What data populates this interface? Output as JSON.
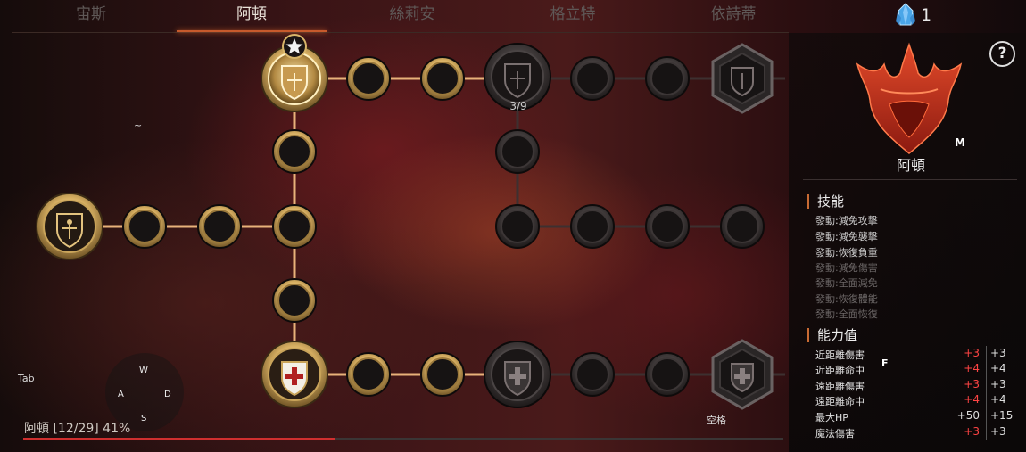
{
  "tabs": [
    {
      "label": "宙斯"
    },
    {
      "label": "阿頓"
    },
    {
      "label": "絲莉安"
    },
    {
      "label": "格立特"
    },
    {
      "label": "依詩蒂"
    }
  ],
  "active_tab": 1,
  "currency": {
    "icon": "crystal-icon",
    "count": "1",
    "color": "#4aa6e8"
  },
  "help": {
    "label": "?"
  },
  "character": {
    "name": "阿頓",
    "emblem_icon": "winged-crest-icon",
    "emblem_color": "#c2331f",
    "hotkey": "M"
  },
  "skills": {
    "title": "技能",
    "items": [
      {
        "label": "發動:減免攻擊",
        "active": true
      },
      {
        "label": "發動:減免襲擊",
        "active": true
      },
      {
        "label": "發動:恢復負重",
        "active": true
      },
      {
        "label": "發動:減免傷害",
        "active": false
      },
      {
        "label": "發動:全面減免",
        "active": false
      },
      {
        "label": "發動:恢復體能",
        "active": false
      },
      {
        "label": "發動:全面恢復",
        "active": false
      }
    ]
  },
  "stats": {
    "title": "能力值",
    "hotkey": "F",
    "rows": [
      {
        "label": "近距離傷害",
        "bonus": "+3",
        "total": "+3"
      },
      {
        "label": "近距離命中",
        "bonus": "+4",
        "total": "+4"
      },
      {
        "label": "遠距離傷害",
        "bonus": "+3",
        "total": "+3"
      },
      {
        "label": "遠距離命中",
        "bonus": "+4",
        "total": "+4"
      },
      {
        "label": "最大HP",
        "bonus": "+50",
        "total": "+15"
      },
      {
        "label": "魔法傷害",
        "bonus": "+3",
        "total": "+3"
      }
    ]
  },
  "tree": {
    "milestone_count": "3/9",
    "progress_label": "阿頓 [12/29] 41%",
    "progress_fraction": 0.41,
    "colors": {
      "active_line": "#e8b27a",
      "inactive_line": "#3d3030",
      "active_ring": "#d9b56a",
      "fill_bar": "#d02f2f"
    }
  },
  "hotkeys": {
    "tilde": "~",
    "tab": "Tab",
    "w": "W",
    "a": "A",
    "s": "S",
    "d": "D",
    "space": "空格"
  }
}
